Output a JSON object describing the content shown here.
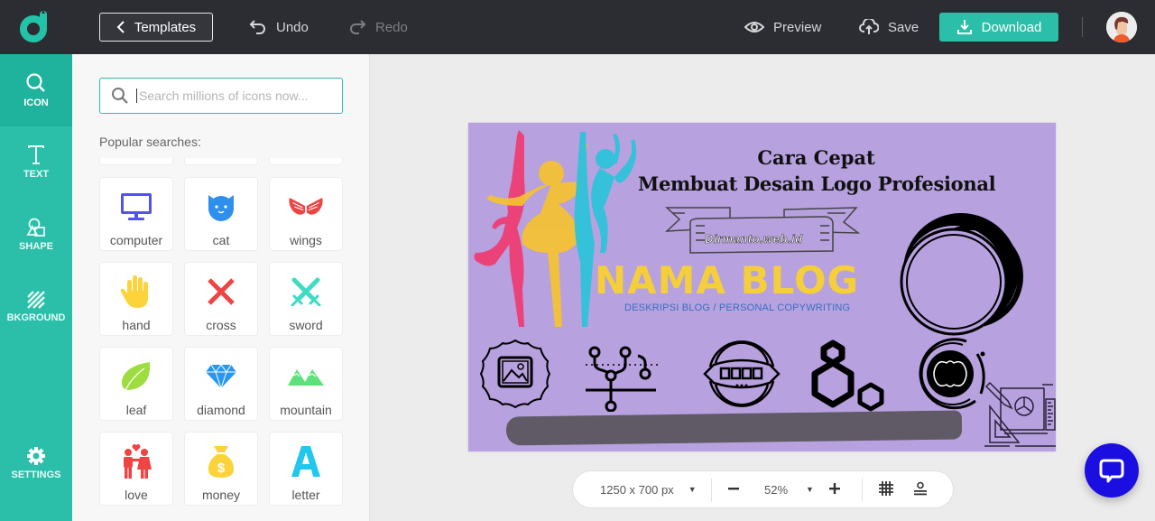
{
  "topbar": {
    "templates_label": "Templates",
    "undo_label": "Undo",
    "redo_label": "Redo",
    "preview_label": "Preview",
    "save_label": "Save",
    "download_label": "Download",
    "brand_color": "#2bbfa9"
  },
  "rail": {
    "items": [
      {
        "label": "ICON",
        "icon": "search-icon",
        "active": true
      },
      {
        "label": "TEXT",
        "icon": "text-icon",
        "active": false
      },
      {
        "label": "SHAPE",
        "icon": "shape-icon",
        "active": false
      },
      {
        "label": "BKGROUND",
        "icon": "background-icon",
        "active": false
      },
      {
        "label": "SETTINGS",
        "icon": "gear-icon",
        "active": false
      }
    ]
  },
  "panel": {
    "search_placeholder": "Search millions of icons now...",
    "search_value": "",
    "popular_label": "Popular searches:",
    "icons": [
      {
        "label": "computer",
        "icon": "computer-icon",
        "color": "#5352ed"
      },
      {
        "label": "cat",
        "icon": "cat-icon",
        "color": "#2e8fec"
      },
      {
        "label": "wings",
        "icon": "wings-icon",
        "color": "#ee4444"
      },
      {
        "label": "hand",
        "icon": "hand-icon",
        "color": "#fcd33b"
      },
      {
        "label": "cross",
        "icon": "cross-icon",
        "color": "#ef4444"
      },
      {
        "label": "sword",
        "icon": "sword-icon",
        "color": "#3fdcc3"
      },
      {
        "label": "leaf",
        "icon": "leaf-icon",
        "color": "#9ddd3f"
      },
      {
        "label": "diamond",
        "icon": "diamond-icon",
        "color": "#2a97ee"
      },
      {
        "label": "mountain",
        "icon": "mountain-icon",
        "color": "#5ee07a"
      },
      {
        "label": "love",
        "icon": "love-icon",
        "color": "#ee4444"
      },
      {
        "label": "money",
        "icon": "money-icon",
        "color": "#fcd33b"
      },
      {
        "label": "letter",
        "icon": "letter-icon",
        "color": "#22c7ee"
      }
    ]
  },
  "canvas": {
    "background": "#b7a1df",
    "title_line1": "Cara Cepat",
    "title_line2": "Membuat Desain Logo Profesional",
    "ribbon_text": "Dirmanto.web.id",
    "blog_name": "NAMA BLOG",
    "blog_description": "DESKRIPSI BLOG / PERSONAL COPYWRITING"
  },
  "bottombar": {
    "canvas_size": "1250 x 700 px",
    "zoom_level": "52%"
  }
}
